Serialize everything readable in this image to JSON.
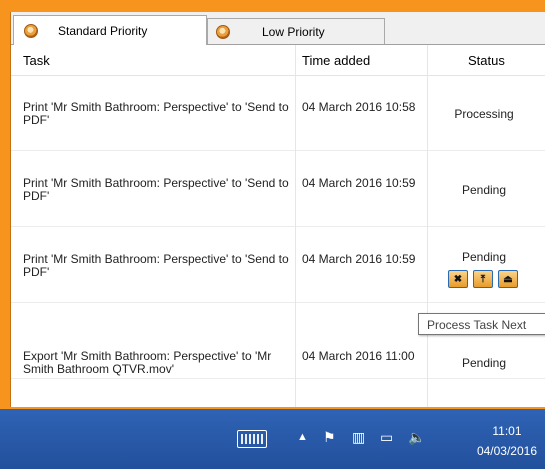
{
  "tabs": [
    {
      "label": "Standard Priority",
      "active": true
    },
    {
      "label": "Low Priority",
      "active": false
    }
  ],
  "columns": {
    "task": "Task",
    "time": "Time added",
    "status": "Status"
  },
  "rows": [
    {
      "task": "Print 'Mr Smith Bathroom: Perspective' to 'Send to PDF'",
      "time": "04 March 2016 10:58",
      "status": "Processing"
    },
    {
      "task": "Print 'Mr Smith Bathroom: Perspective' to 'Send to PDF'",
      "time": "04 March 2016 10:59",
      "status": "Pending"
    },
    {
      "task": "Print 'Mr Smith Bathroom: Perspective' to 'Send to PDF'",
      "time": "04 March 2016 10:59",
      "status": "Pending"
    },
    {
      "task": "Export 'Mr Smith Bathroom: Perspective' to 'Mr Smith Bathroom QTVR.mov'",
      "time": "04 March 2016 11:00",
      "status": "Pending"
    }
  ],
  "row_actions": [
    {
      "icon": "cancel-icon",
      "glyph": "✖"
    },
    {
      "icon": "move-to-top-icon",
      "glyph": "⤒"
    },
    {
      "icon": "move-down-icon",
      "glyph": "⏏"
    }
  ],
  "tooltip": "Process Task Next",
  "taskbar": {
    "time": "11:01",
    "date": "04/03/2016",
    "tray_icons": [
      "keyboard-icon",
      "chevron-up-icon",
      "flag-icon",
      "network-icon",
      "display-icon",
      "volume-icon"
    ]
  },
  "colors": {
    "frame": "#f7941d",
    "taskbar": "#2a5aa8"
  }
}
